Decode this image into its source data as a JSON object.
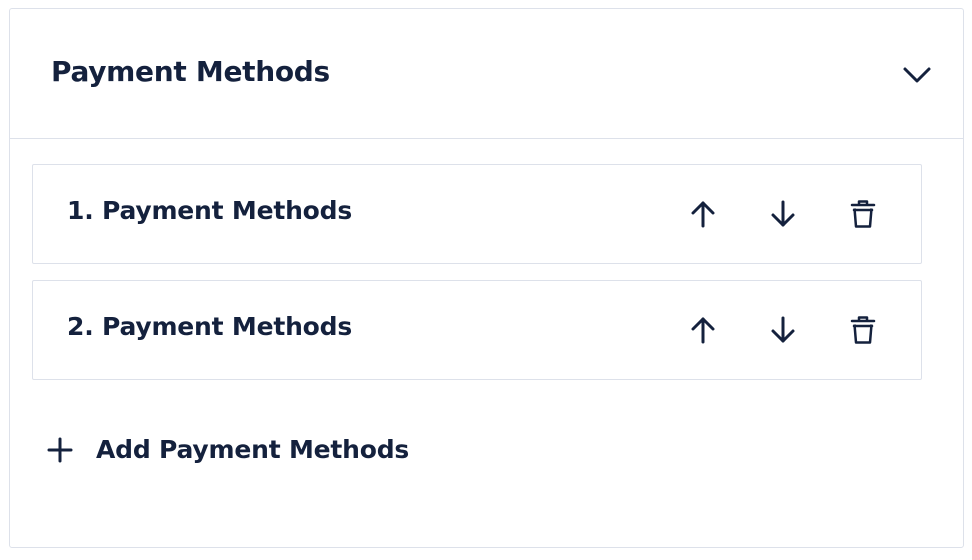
{
  "section": {
    "title": "Payment Methods",
    "collapse_icon": "chevron-down-icon"
  },
  "items": [
    {
      "label": "1. Payment Methods"
    },
    {
      "label": "2. Payment Methods"
    }
  ],
  "item_actions": {
    "move_up_icon": "arrow-up-icon",
    "move_down_icon": "arrow-down-icon",
    "delete_icon": "trash-icon"
  },
  "add_button": {
    "label": "Add Payment Methods",
    "icon": "plus-icon"
  },
  "colors": {
    "text": "#14213d",
    "border": "#dde1ea",
    "background": "#ffffff"
  }
}
